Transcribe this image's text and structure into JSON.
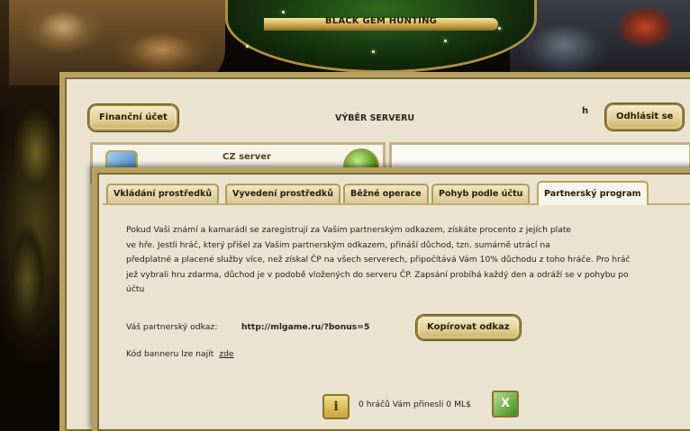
{
  "header": {
    "banner_title": "BLACK GEM HUNTING"
  },
  "main": {
    "finance_button": "Finanční účet",
    "server_select_title": "VÝBĚR SERVERU",
    "user_initial": "h",
    "logout_button": "Odhlásit se",
    "server": {
      "name": "CZ server",
      "icon": "server-icon",
      "action_icon": "go-arrow-icon"
    }
  },
  "overlay": {
    "tabs": [
      {
        "label": "Vkládání prostředků",
        "active": false
      },
      {
        "label": "Vyvedení prostředků",
        "active": false
      },
      {
        "label": "Běžné operace",
        "active": false
      },
      {
        "label": "Pohyb podle účtu",
        "active": false
      },
      {
        "label": "Partnerský program",
        "active": true
      }
    ],
    "description": "Pokud Vaši známí a kamarádi se zaregistrují za Vašim partnerským odkazem, získáte procento z jejích plate\nve hře. Jestli hráč, který přišel za Vašim partnerským odkazem, přináší důchod, tzn. sumárně utrácí na\npředplatné a placené služby více, než získal ČP na všech serverech, připočítává Vám 10% důchodu z toho hráče.  Pro hráč\njež vybrali hru zdarma, důchod je v podobě vložených do serveru ČP. Zapsání probíhá každý den a odráží se v pohybu po\núčtu",
    "partner_link_label": "Váš partnerský odkaz:",
    "partner_link_url": "http://mlgame.ru/?bonus=5",
    "copy_button": "Kopírovat odkaz",
    "banner_code_label": "Kód banneru lze najít",
    "banner_code_link": "zde",
    "stats_text": "0 hráčů Vám přinesli 0 ML$",
    "info_icon": "info-icon",
    "export_icon": "excel-export-icon"
  },
  "colors": {
    "panel_bg": "#e9e3cf",
    "gold_border": "#b8a160",
    "text": "#2b2212"
  }
}
